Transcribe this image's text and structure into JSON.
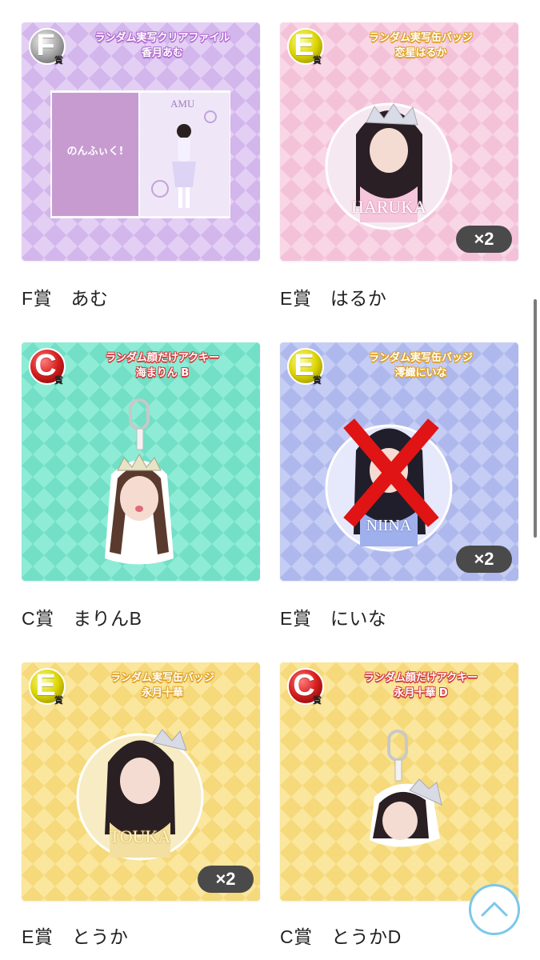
{
  "items": [
    {
      "badge": "F",
      "sho": "賞",
      "title_line1": "ランダム実写クリアファイル",
      "title_line2": "香月あむ",
      "caption": "F賞　あむ",
      "qty": "",
      "logo_text": "のんふぃく!",
      "name_text": "AMU"
    },
    {
      "badge": "E",
      "sho": "賞",
      "title_line1": "ランダム実写缶バッジ",
      "title_line2": "恋星はるか",
      "caption": "E賞　はるか",
      "qty": "×2",
      "name_text": "HARUKA"
    },
    {
      "badge": "C",
      "sho": "賞",
      "title_line1": "ランダム顔だけアクキー",
      "title_line2": "海まりん B",
      "caption": "C賞　まりんB",
      "qty": ""
    },
    {
      "badge": "E",
      "sho": "賞",
      "title_line1": "ランダム実写缶バッジ",
      "title_line2": "澪織にいな",
      "caption": "E賞　にいな",
      "qty": "×2",
      "name_text": "NIINA"
    },
    {
      "badge": "E",
      "sho": "賞",
      "title_line1": "ランダム実写缶バッジ",
      "title_line2": "永月十華",
      "caption": "E賞　とうか",
      "qty": "×2",
      "name_text": "TOUKA"
    },
    {
      "badge": "C",
      "sho": "賞",
      "title_line1": "ランダム顔だけアクキー",
      "title_line2": "永月十華 D",
      "caption": "C賞　とうかD",
      "qty": ""
    }
  ],
  "colors": {
    "purple_bg": "#dcc3f0",
    "pink_bg": "#f7cde0",
    "mint_bg": "#7fe6cf",
    "periwinkle_bg": "#b9c2f0",
    "yellow_bg": "#f8e08a",
    "badge_f": "#9a9a9a",
    "badge_e": "#d9d600",
    "badge_c": "#d32020",
    "accent_scroll_top": "#7cc8e8"
  },
  "icons": {
    "scroll_top": "chevron-up-icon",
    "sold_out_mark": "cross-icon"
  }
}
